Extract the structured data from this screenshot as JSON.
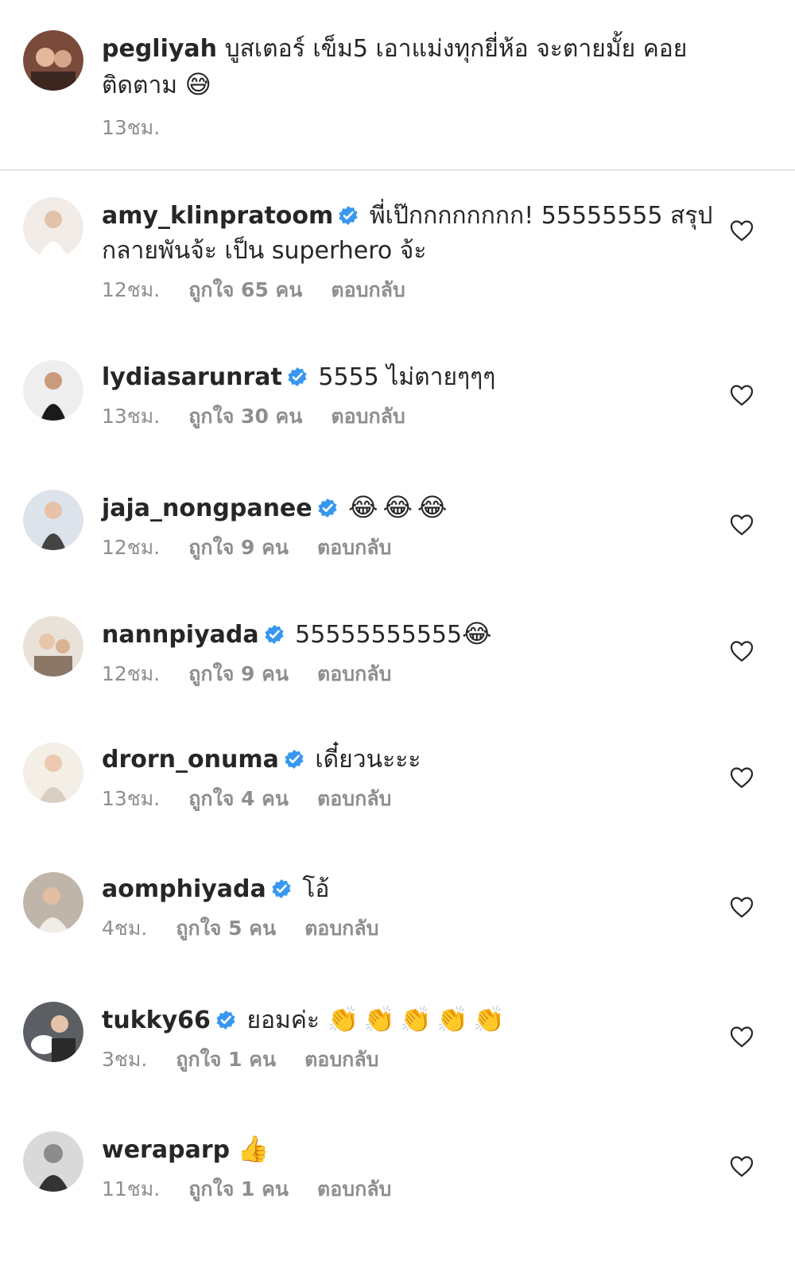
{
  "caption": {
    "username": "pegliyah",
    "text": "บูสเตอร์ เข็ม5 เอาแม่งทุกยี่ห้อ จะตายมั้ย คอยติดตาม",
    "emoji": "😅",
    "time": "13ชม."
  },
  "comments": [
    {
      "username": "amy_klinpratoom",
      "verified": true,
      "text": "พี่เป๊กกกกกกกก! 55555555 สรุปกลายพันจ้ะ เป็น superhero จ้ะ",
      "emoji": "",
      "time": "12ชม.",
      "likes": "ถูกใจ 65 คน",
      "reply": "ตอบกลับ"
    },
    {
      "username": "lydiasarunrat",
      "verified": true,
      "text": "5555 ไม่ตายๆๆๆ",
      "emoji": "",
      "time": "13ชม.",
      "likes": "ถูกใจ 30 คน",
      "reply": "ตอบกลับ"
    },
    {
      "username": "jaja_nongpanee",
      "verified": true,
      "text": "",
      "emoji": "😂😂😂",
      "time": "12ชม.",
      "likes": "ถูกใจ 9 คน",
      "reply": "ตอบกลับ"
    },
    {
      "username": "nannpiyada",
      "verified": true,
      "text": "55555555555",
      "emoji": "😂",
      "time": "12ชม.",
      "likes": "ถูกใจ 9 คน",
      "reply": "ตอบกลับ"
    },
    {
      "username": "drorn_onuma",
      "verified": true,
      "text": "เดี๋ยวนะะะ",
      "emoji": "",
      "time": "13ชม.",
      "likes": "ถูกใจ 4 คน",
      "reply": "ตอบกลับ"
    },
    {
      "username": "aomphiyada",
      "verified": true,
      "text": "โอ้",
      "emoji": "",
      "time": "4ชม.",
      "likes": "ถูกใจ 5 คน",
      "reply": "ตอบกลับ"
    },
    {
      "username": "tukky66",
      "verified": true,
      "text": "ยอมค่ะ",
      "emoji": "👏👏👏👏👏",
      "time": "3ชม.",
      "likes": "ถูกใจ 1 คน",
      "reply": "ตอบกลับ"
    },
    {
      "username": "weraparp",
      "verified": false,
      "text": "",
      "emoji": "👍",
      "time": "11ชม.",
      "likes": "ถูกใจ 1 คน",
      "reply": "ตอบกลับ"
    }
  ],
  "icons": {
    "heart": "heart-outline-icon",
    "verified": "verified-badge-icon"
  },
  "colors": {
    "text": "#262626",
    "meta": "#8e8e8e",
    "verified": "#3897f0",
    "divider": "#e2e2e2"
  }
}
